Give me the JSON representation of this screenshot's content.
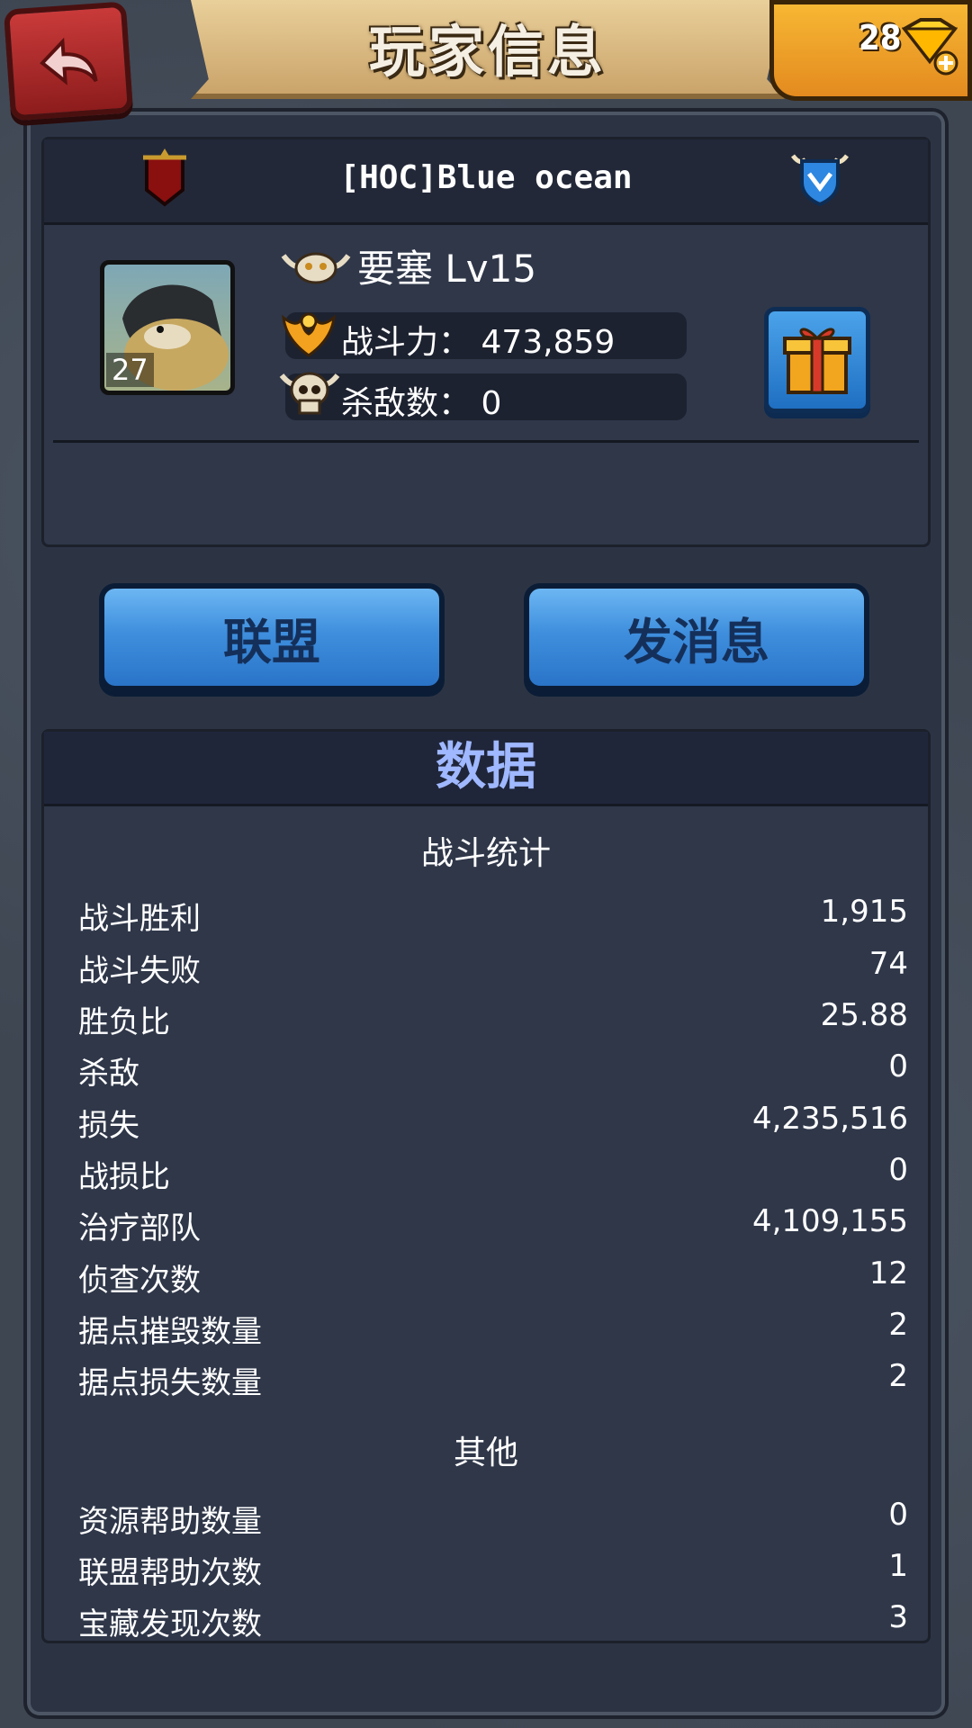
{
  "header": {
    "title": "玩家信息",
    "gems": "28"
  },
  "profile": {
    "name": "[HOC]Blue ocean",
    "avatar_level": "27",
    "rank": "要塞 Lv15",
    "power_label": "战斗力：",
    "power_value": "473,859",
    "kills_label": "杀敌数：",
    "kills_value": "0"
  },
  "buttons": {
    "alliance": "联盟",
    "message": "发消息"
  },
  "data": {
    "title": "数据",
    "battle_section": "战斗统计",
    "battle_stats": [
      {
        "label": "战斗胜利",
        "value": "1,915"
      },
      {
        "label": "战斗失败",
        "value": "74"
      },
      {
        "label": "胜负比",
        "value": "25.88"
      },
      {
        "label": "杀敌",
        "value": "0"
      },
      {
        "label": "损失",
        "value": "4,235,516"
      },
      {
        "label": "战损比",
        "value": "0"
      },
      {
        "label": "治疗部队",
        "value": "4,109,155"
      },
      {
        "label": "侦查次数",
        "value": "12"
      },
      {
        "label": "据点摧毁数量",
        "value": "2"
      },
      {
        "label": "据点损失数量",
        "value": "2"
      }
    ],
    "other_section": "其他",
    "other_stats": [
      {
        "label": "资源帮助数量",
        "value": "0"
      },
      {
        "label": "联盟帮助次数",
        "value": "1"
      },
      {
        "label": "宝藏发现次数",
        "value": "3"
      }
    ]
  },
  "icons": {
    "back": "back-arrow-icon",
    "gem": "gem-icon",
    "flag": "flag-icon",
    "shield": "shield-icon",
    "rank": "horned-skull-icon",
    "power": "phoenix-icon",
    "kills": "skull-icon",
    "gift": "gift-icon"
  }
}
